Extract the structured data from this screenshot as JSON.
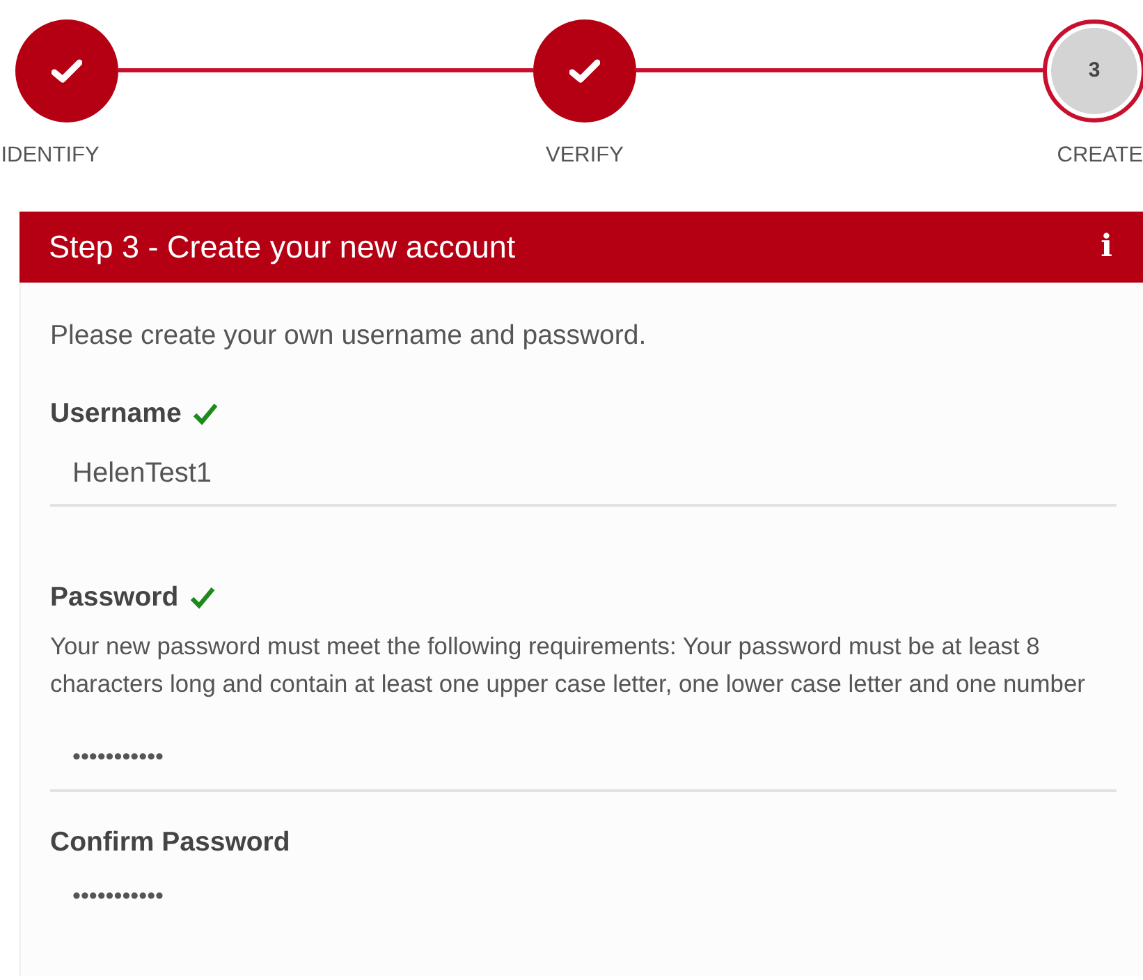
{
  "steps": [
    {
      "label": "IDENTIFY",
      "completed": true
    },
    {
      "label": "VERIFY",
      "completed": true
    },
    {
      "label": "CREATE",
      "completed": false,
      "number": "3"
    }
  ],
  "panel": {
    "title": "Step 3 - Create your new account",
    "info_icon": "i",
    "intro": "Please create your own username and password."
  },
  "fields": [
    {
      "label": "Username",
      "valid": true,
      "value": "HelenTest1"
    },
    {
      "label": "Password",
      "valid": true,
      "help": "Your new password must meet the following requirements: Your password must be at least 8 characters long and contain at least one upper case letter, one lower case letter and one number",
      "value": "•••••••••••"
    },
    {
      "label": "Confirm Password",
      "valid": false,
      "value": "•••••••••••"
    }
  ]
}
